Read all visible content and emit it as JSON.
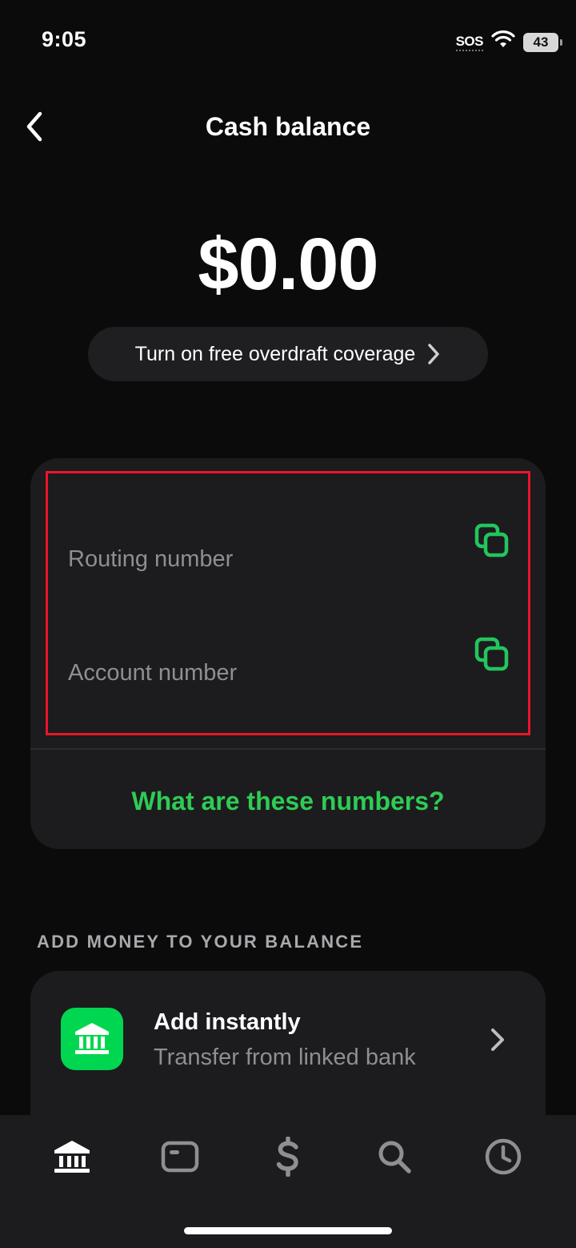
{
  "status_bar": {
    "time": "9:05",
    "sos": "SOS",
    "battery": "43",
    "icons": [
      "wifi-icon",
      "battery-icon"
    ]
  },
  "header": {
    "title": "Cash balance",
    "back_icon": "chevron-left-icon"
  },
  "balance": {
    "amount": "$0.00"
  },
  "overdraft": {
    "label": "Turn on free overdraft coverage",
    "icon": "chevron-right-icon"
  },
  "numbers_card": {
    "routing_label": "Routing number",
    "account_label": "Account number",
    "copy_icon": "copy-icon",
    "link_label": "What are these numbers?",
    "highlight_color": "#e8152b"
  },
  "add_money": {
    "heading": "ADD MONEY TO YOUR BALANCE",
    "item": {
      "title": "Add instantly",
      "subtitle": "Transfer from linked bank",
      "icon": "bank-icon"
    }
  },
  "tab_bar": {
    "tabs": [
      "home-icon",
      "card-icon",
      "dollar-icon",
      "search-icon",
      "clock-icon"
    ],
    "active": "home-icon"
  },
  "colors": {
    "accent_green": "#00d64f",
    "link_green": "#2ecc55",
    "background": "#0b0b0c",
    "card": "#1c1c1e"
  }
}
